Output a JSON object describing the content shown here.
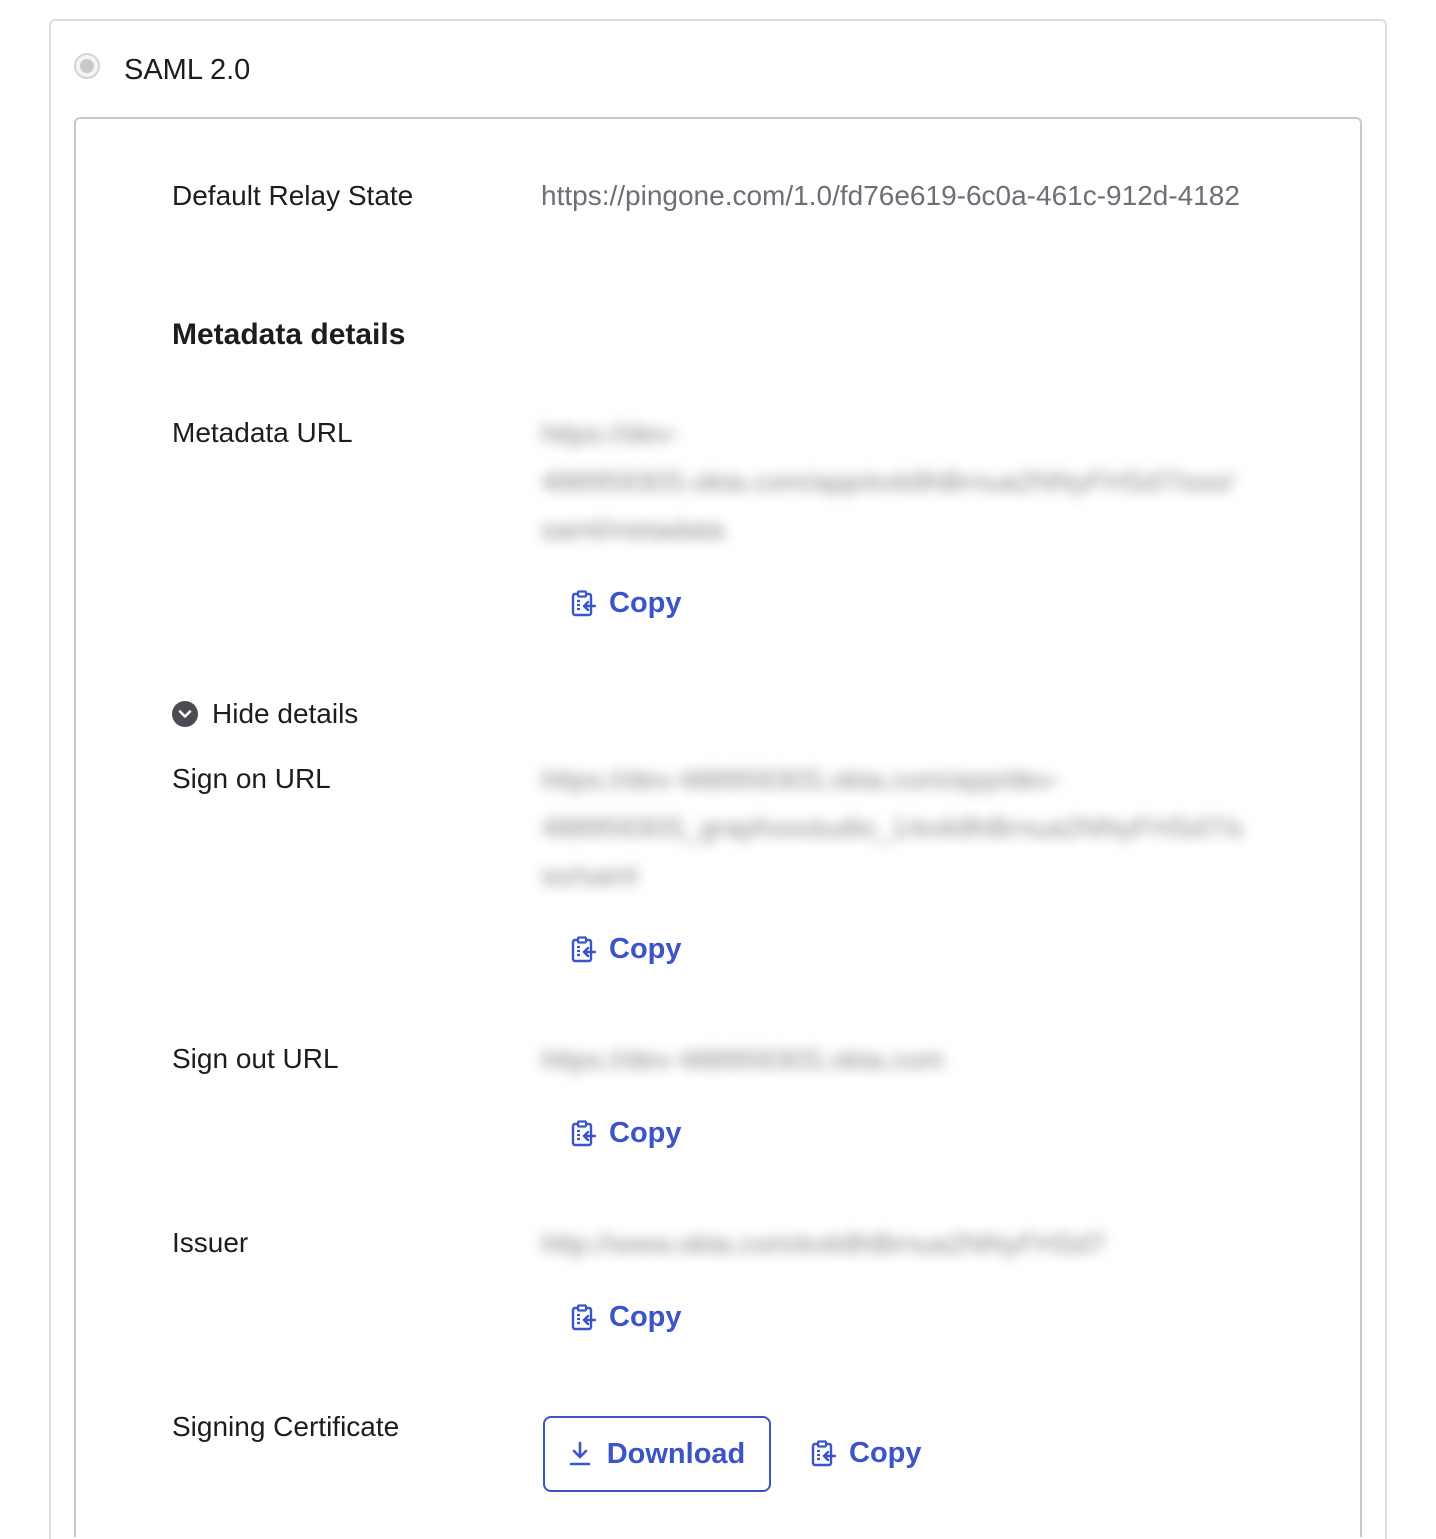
{
  "protocol": {
    "label": "SAML 2.0",
    "selected": false
  },
  "relay_state": {
    "label": "Default Relay State",
    "value": "https://pingone.com/1.0/fd76e619-6c0a-461c-912d-4182"
  },
  "metadata": {
    "heading": "Metadata details",
    "url_label": "Metadata URL",
    "url_lines": [
      "https://dev-",
      "48895930S.okta.com/app/exk8hBrnua2NNyFHSd7/sso/",
      "saml/metadata"
    ],
    "copy_label": "Copy"
  },
  "toggle": {
    "label": "Hide details"
  },
  "sign_on": {
    "label": "Sign on URL",
    "lines": [
      "https://dev-48895930S.okta.com/app/dev-",
      "48895930S_graphosstudio_1/exk8hBrnua2NNyFHSd7/s",
      "so/saml"
    ],
    "copy_label": "Copy"
  },
  "sign_out": {
    "label": "Sign out URL",
    "lines": [
      "https://dev-48895930S.okta.com"
    ],
    "copy_label": "Copy"
  },
  "issuer": {
    "label": "Issuer",
    "lines": [
      "http://www.okta.com/exk8hBrnua2NNyFHSd7"
    ],
    "copy_label": "Copy"
  },
  "certificate": {
    "label": "Signing Certificate",
    "download_label": "Download",
    "copy_label": "Copy"
  },
  "colors": {
    "accent": "#3b55c9",
    "muted_text": "#6e6e78",
    "border": "#c9c9cc"
  },
  "icons": {
    "copy": "clipboard-copy-icon",
    "download": "download-icon",
    "toggle": "chevron-down-icon"
  }
}
